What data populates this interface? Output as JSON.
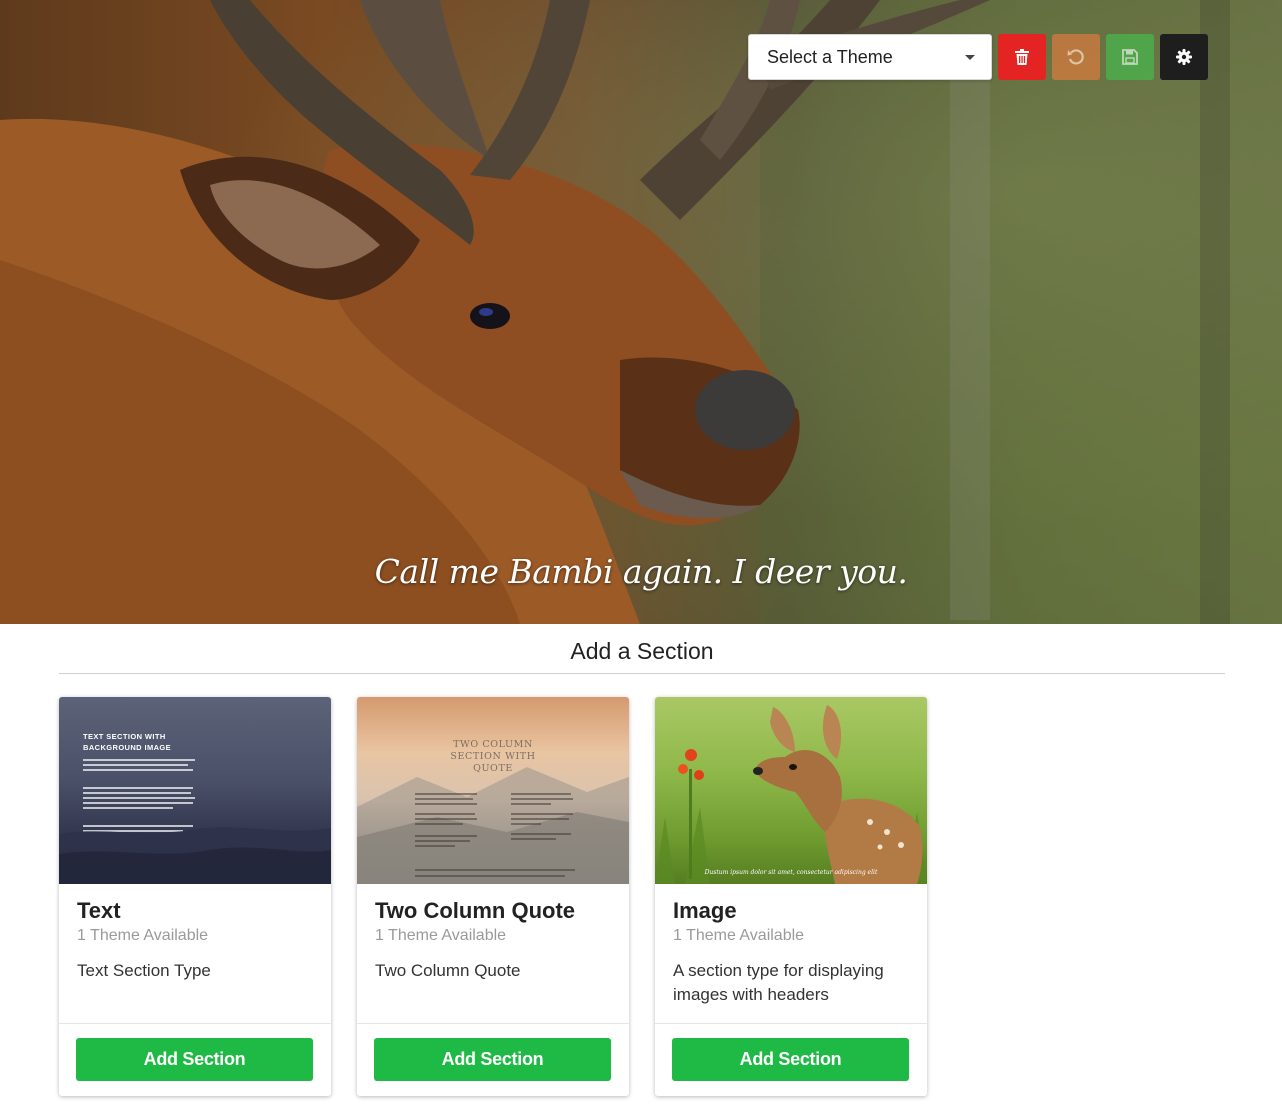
{
  "hero": {
    "caption": "Call me Bambi again.  I deer you."
  },
  "toolbar": {
    "theme_select": {
      "value": "Select a Theme"
    },
    "buttons": {
      "delete": {
        "icon": "trash-icon",
        "color": "#e32423"
      },
      "undo": {
        "icon": "undo-icon",
        "color": "#c87a3f"
      },
      "save": {
        "icon": "floppy-icon",
        "color": "#4cae4c"
      },
      "settings": {
        "icon": "gear-icon",
        "color": "#1e1e1e"
      }
    }
  },
  "section_picker": {
    "heading": "Add a Section",
    "cards": [
      {
        "title": "Text",
        "themes": "1 Theme Available",
        "description": "Text Section Type",
        "button": "Add Section",
        "thumbnail": {
          "heading": "TEXT SECTION WITH BACKGROUND IMAGE"
        }
      },
      {
        "title": "Two Column Quote",
        "themes": "1 Theme Available",
        "description": "Two Column Quote",
        "button": "Add Section",
        "thumbnail": {
          "heading": "TWO COLUMN SECTION WITH QUOTE"
        }
      },
      {
        "title": "Image",
        "themes": "1 Theme Available",
        "description": "A section type for displaying images with headers",
        "button": "Add Section",
        "thumbnail": {
          "caption": "Dustum ipsum dolor sit amet, consectetur adipiscing elit"
        }
      }
    ]
  },
  "colors": {
    "primary_button": "#1fba45",
    "muted_text": "#9a9a9a"
  }
}
